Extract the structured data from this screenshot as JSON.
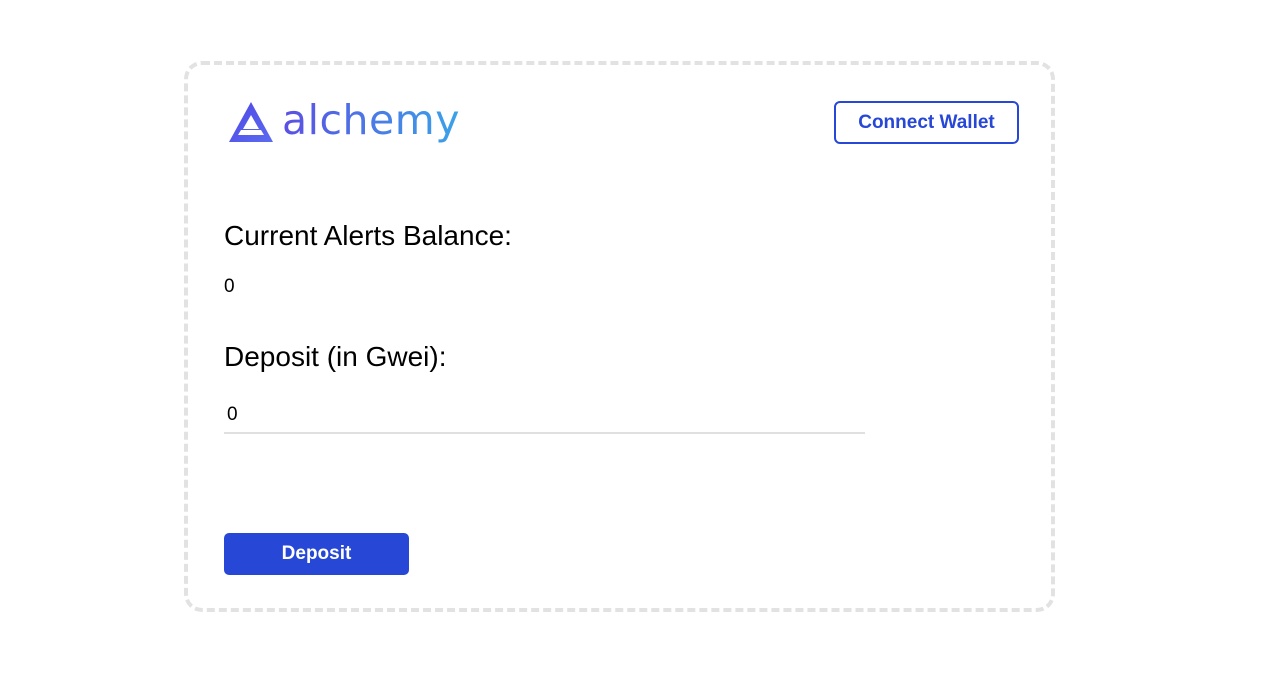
{
  "header": {
    "logo_text": "alchemy",
    "logo_icon": "alchemy-triangle-icon",
    "connect_label": "Connect Wallet"
  },
  "balance": {
    "label": "Current Alerts Balance:",
    "value": "0"
  },
  "deposit": {
    "label": "Deposit (in Gwei):",
    "input_value": "0",
    "button_label": "Deposit"
  },
  "colors": {
    "primary": "#2747d6",
    "logo_gradient_start": "#5b4fe4",
    "logo_gradient_end": "#3aa3e8",
    "card_border": "#e2e2e2"
  }
}
